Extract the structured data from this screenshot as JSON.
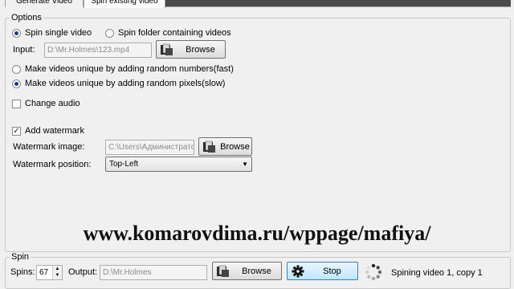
{
  "tabs": [
    {
      "label": "Generate Video",
      "active": false
    },
    {
      "label": "Spin existing video",
      "active": true
    }
  ],
  "options": {
    "title": "Options",
    "spin_single_label": "Spin single video",
    "spin_folder_label": "Spin folder containing videos",
    "input_label": "Input:",
    "input_value": "D:\\Mr.Holmes\\123.mp4",
    "browse_label": "Browse",
    "unique_numbers_label": "Make videos unique by adding random numbers(fast)",
    "unique_pixels_label": "Make videos unique by adding random pixels(slow)",
    "change_audio_label": "Change audio",
    "add_watermark_label": "Add watermark",
    "watermark_image_label": "Watermark image:",
    "watermark_image_value": "C:\\Users\\Администрато",
    "watermark_browse_label": "Browse",
    "watermark_position_label": "Watermark position:",
    "watermark_position_value": "Top-Left"
  },
  "overlay_url": "www.komarovdima.ru/wppage/mafiya/",
  "spin": {
    "title": "Spin",
    "spins_label": "Spins:",
    "spins_value": "67",
    "output_label": "Output:",
    "output_value": "D:\\Mr.Holmes",
    "browse_label": "Browse",
    "stop_label": "Stop",
    "status_text": "Spining video 1, copy 1"
  },
  "icons": {
    "browse": "folder-icon",
    "stop": "gear-icon",
    "spinner": "spinner-icon"
  },
  "colors": {
    "radio_dot": "#1f3a8a",
    "window_bg": "#f0f0f0"
  }
}
